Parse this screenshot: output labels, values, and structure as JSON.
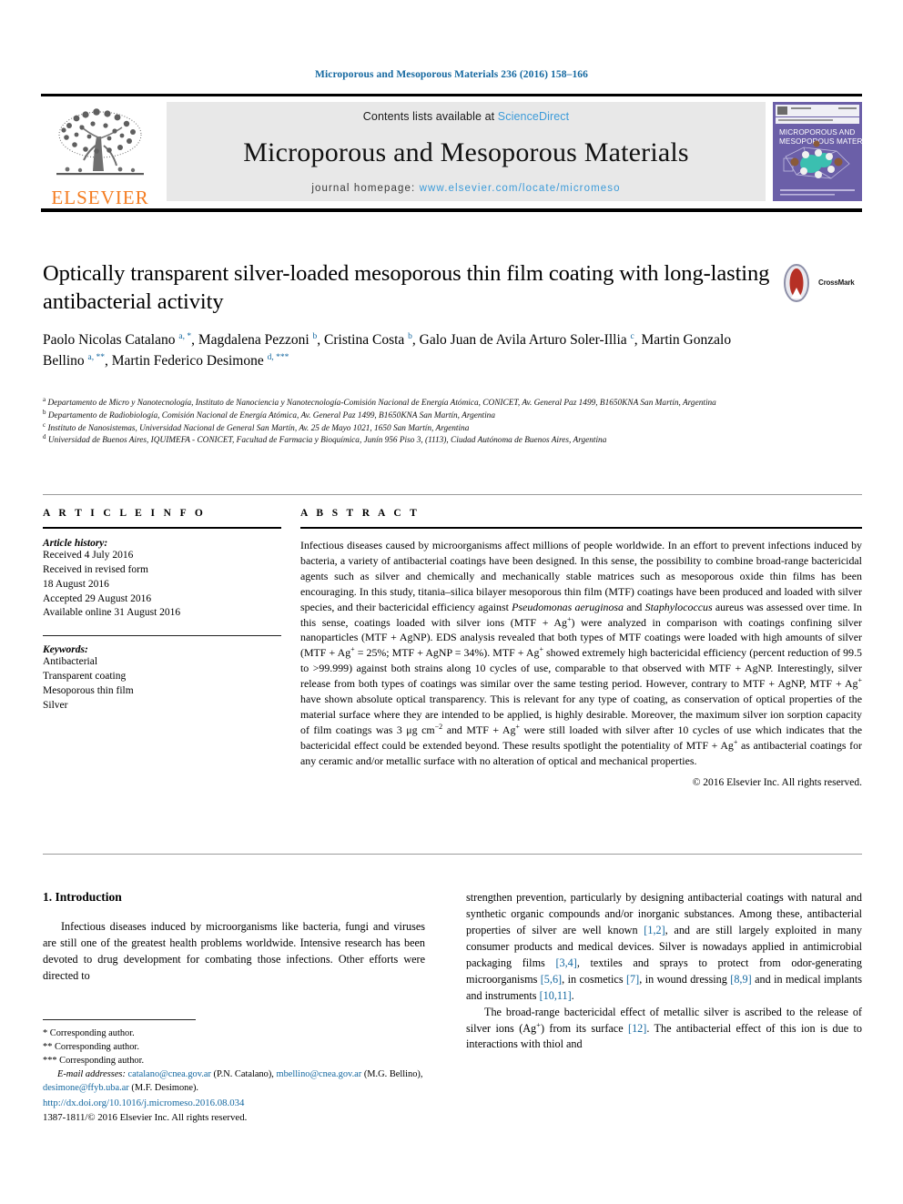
{
  "running_head": "Microporous and Mesoporous Materials 236 (2016) 158–166",
  "masthead": {
    "contents_prefix": "Contents lists available at ",
    "sciencedirect": "ScienceDirect",
    "journal_name": "Microporous and Mesoporous Materials",
    "homepage_prefix": "journal homepage: ",
    "homepage_url": "www.elsevier.com/locate/micromeso",
    "publisher_logo_text": "ELSEVIER",
    "cover_title_line1": "MICROPOROUS AND",
    "cover_title_line2": "MESOPOROUS MATERIALS",
    "accent_link_color": "#3c9bd9",
    "elsevier_orange": "#f47c20",
    "cover_purple": "#6b5fa8"
  },
  "crossmark": {
    "label": "CrossMark"
  },
  "article": {
    "title": "Optically transparent silver-loaded mesoporous thin film coating with long-lasting antibacterial activity",
    "authors_html": "Paolo Nicolas Catalano <sup>a, *</sup>, Magdalena Pezzoni <sup>b</sup>, Cristina Costa <sup>b</sup>, Galo Juan de Avila Arturo Soler-Illia <sup>c</sup>, Martin Gonzalo Bellino <sup>a, **</sup>, Martin Federico Desimone <sup>d, ***</sup>",
    "affiliations": [
      "Departamento de Micro y Nanotecnología, Instituto de Nanociencia y Nanotecnología-Comisión Nacional de Energía Atómica, CONICET, Av. General Paz 1499, B1650KNA San Martín, Argentina",
      "Departamento de Radiobiología, Comisión Nacional de Energía Atómica, Av. General Paz 1499, B1650KNA San Martín, Argentina",
      "Instituto de Nanosistemas, Universidad Nacional de General San Martín, Av. 25 de Mayo 1021, 1650 San Martín, Argentina",
      "Universidad de Buenos Aires, IQUIMEFA - CONICET, Facultad de Farmacia y Bioquímica, Junín 956 Piso 3, (1113), Ciudad Autónoma de Buenos Aires, Argentina"
    ],
    "affiliation_markers": [
      "a",
      "b",
      "c",
      "d"
    ]
  },
  "article_info": {
    "heading": "A R T I C L E   I N F O",
    "history_label": "Article history:",
    "history_lines": [
      "Received 4 July 2016",
      "Received in revised form",
      "18 August 2016",
      "Accepted 29 August 2016",
      "Available online 31 August 2016"
    ],
    "keywords_label": "Keywords:",
    "keywords": [
      "Antibacterial",
      "Transparent coating",
      "Mesoporous thin film",
      "Silver"
    ]
  },
  "abstract": {
    "heading": "A B S T R A C T",
    "body_html": "Infectious diseases caused by microorganisms affect millions of people worldwide. In an effort to prevent infections induced by bacteria, a variety of antibacterial coatings have been designed. In this sense, the possibility to combine broad-range bactericidal agents such as silver and chemically and mechanically stable matrices such as mesoporous oxide thin films has been encouraging. In this study, titania–silica bilayer mesoporous thin film (MTF) coatings have been produced and loaded with silver species, and their bactericidal efficiency against <i>Pseudomonas aeruginosa</i> and <i>Staphylococcus</i> aureus was assessed over time. In this sense, coatings loaded with silver ions (MTF + Ag<sup>+</sup>) were analyzed in comparison with coatings confining silver nanoparticles (MTF + AgNP). EDS analysis revealed that both types of MTF coatings were loaded with high amounts of silver (MTF + Ag<sup>+</sup> = 25%; MTF + AgNP = 34%). MTF + Ag<sup>+</sup> showed extremely high bactericidal efficiency (percent reduction of 99.5 to &gt;99.999) against both strains along 10 cycles of use, comparable to that observed with MTF + AgNP. Interestingly, silver release from both types of coatings was similar over the same testing period. However, contrary to MTF + AgNP, MTF + Ag<sup>+</sup> have shown absolute optical transparency. This is relevant for any type of coating, as conservation of optical properties of the material surface where they are intended to be applied, is highly desirable. Moreover, the maximum silver ion sorption capacity of film coatings was 3 μg cm<sup>−2</sup> and MTF + Ag<sup>+</sup> were still loaded with silver after 10 cycles of use which indicates that the bactericidal effect could be extended beyond. These results spotlight the potentiality of MTF + Ag<sup>+</sup> as antibacterial coatings for any ceramic and/or metallic surface with no alteration of optical and mechanical properties.",
    "copyright": "© 2016 Elsevier Inc. All rights reserved."
  },
  "introduction": {
    "heading": "1. Introduction",
    "left_paragraph_html": "Infectious diseases induced by microorganisms like bacteria, fungi and viruses are still one of the greatest health problems worldwide. Intensive research has been devoted to drug development for combating those infections. Other efforts were directed to",
    "right_paragraph_1_html": "strengthen prevention, particularly by designing antibacterial coatings with natural and synthetic organic compounds and/or inorganic substances. Among these, antibacterial properties of silver are well known <span class=\"ref\">[1,2]</span>, and are still largely exploited in many consumer products and medical devices. Silver is nowadays applied in antimicrobial packaging films <span class=\"ref\">[3,4]</span>, textiles and sprays to protect from odor-generating microorganisms <span class=\"ref\">[5,6]</span>, in cosmetics <span class=\"ref\">[7]</span>, in wound dressing <span class=\"ref\">[8,9]</span> and in medical implants and instruments <span class=\"ref\">[10,11]</span>.",
    "right_paragraph_2_html": "The broad-range bactericidal effect of metallic silver is ascribed to the release of silver ions (Ag<sup>+</sup>) from its surface <span class=\"ref\">[12]</span>. The antibacterial effect of this ion is due to interactions with thiol and"
  },
  "footnotes": {
    "corresponding_1": "* Corresponding author.",
    "corresponding_2": "** Corresponding author.",
    "corresponding_3": "*** Corresponding author.",
    "emails_html": "<i>E-mail addresses:</i> <span class=\"link\">catalano@cnea.gov.ar</span> (P.N. Catalano), <span class=\"link\">mbellino@cnea.gov.ar</span> (M.G. Bellino), <span class=\"link\">desimone@ffyb.uba.ar</span> (M.F. Desimone)."
  },
  "footer": {
    "doi": "http://dx.doi.org/10.1016/j.micromeso.2016.08.034",
    "issn_line": "1387-1811/© 2016 Elsevier Inc. All rights reserved."
  }
}
